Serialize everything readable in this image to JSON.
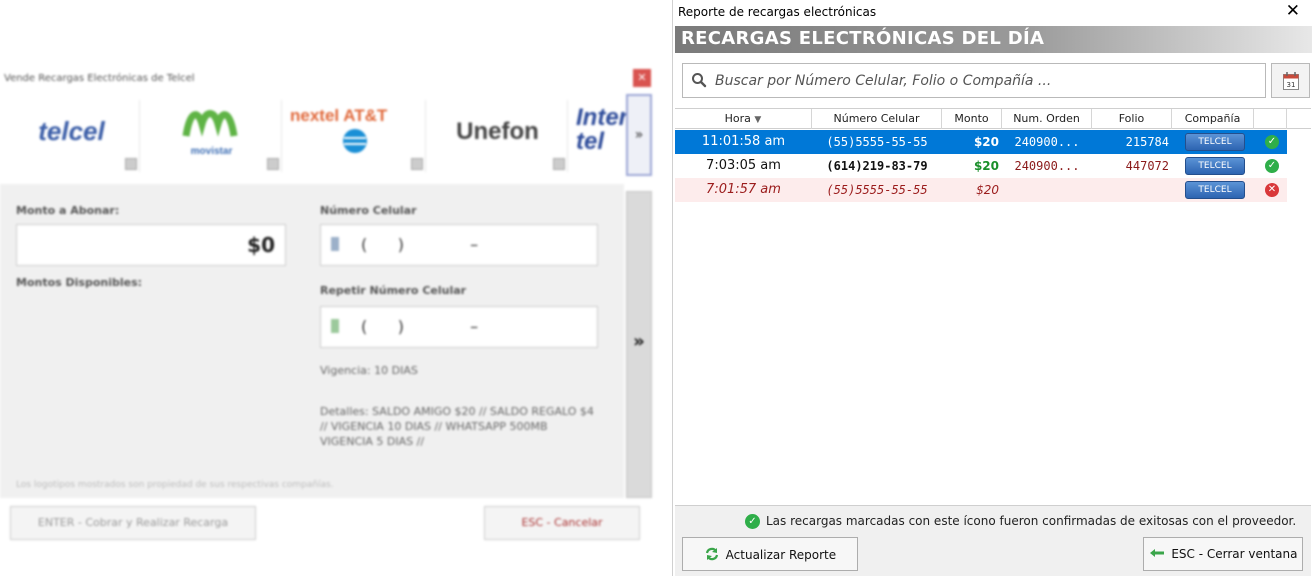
{
  "left_window": {
    "title": "Vende Recargas Electrónicas de Telcel",
    "close": "✕",
    "carriers": [
      {
        "name": "telcel",
        "color": "#3b5ea8"
      },
      {
        "name": "movistar",
        "color": "#5fb446"
      },
      {
        "name": "nextel AT&T",
        "color": "#e0683a"
      },
      {
        "name": "Unefon",
        "color": "#444444"
      },
      {
        "name": "Inter tel",
        "color": "#2d4b9a"
      }
    ],
    "carousel_next": "»",
    "panel_toggle": "»",
    "amount_label": "Monto a Abonar:",
    "amount_value": "$0",
    "available_label": "Montos Disponibles:",
    "phone_label": "Número Celular",
    "phone_mask": "(      )             –",
    "repeat_label": "Repetir Número Celular",
    "vigencia": "Vigencia: 10 DIAS",
    "details": "Detalles: SALDO AMIGO $20 // SALDO REGALO $4 // VIGENCIA 10 DIAS // WHATSAPP 500MB VIGENCIA 5 DIAS //",
    "footnote": "Los logotipos mostrados son propiedad de sus respectivas compañías.",
    "enter_button": "ENTER - Cobrar y Realizar Recarga",
    "esc_button": "ESC - Cancelar"
  },
  "dialog": {
    "title": "Reporte de recargas electrónicas",
    "close": "✕",
    "banner": "RECARGAS ELECTRÓNICAS DEL DÍA",
    "search_placeholder": "Buscar por Número Celular, Folio o Compañía ...",
    "calendar_day": "31",
    "columns": [
      "Hora",
      "Número Celular",
      "Monto",
      "Num. Orden",
      "Folio",
      "Compañía"
    ],
    "sort_indicator": "▼",
    "rows": [
      {
        "hora": "11:01:58 am",
        "numero": "(55)5555-55-55",
        "monto": "$20",
        "orden": "240900...",
        "folio": "215784",
        "compania": "TELCEL",
        "status": "ok",
        "state": "selected"
      },
      {
        "hora": "7:03:05 am",
        "numero": "(614)219-83-79",
        "monto": "$20",
        "orden": "240900...",
        "folio": "447072",
        "compania": "TELCEL",
        "status": "ok",
        "state": "normal"
      },
      {
        "hora": "7:01:57 am",
        "numero": "(55)5555-55-55",
        "monto": "$20",
        "orden": "",
        "folio": "",
        "compania": "TELCEL",
        "status": "error",
        "state": "failed"
      }
    ],
    "footer_note": "Las recargas marcadas con este ícono fueron confirmadas de exitosas con el proveedor.",
    "refresh_button": "Actualizar Reporte",
    "close_button": "ESC - Cerrar ventana",
    "colors": {
      "selected_row": "#0078d7",
      "failed_row": "#fdecec",
      "failed_text": "#9b1c1c",
      "success_green": "#2fae49",
      "error_red": "#d9383a",
      "order_red": "#8b1a1a"
    }
  }
}
